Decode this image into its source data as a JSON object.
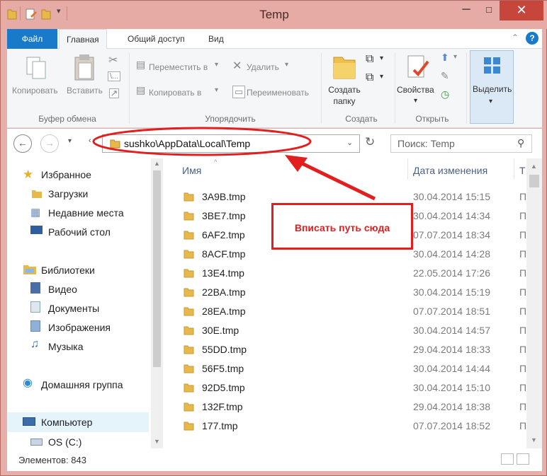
{
  "window": {
    "title": "Temp"
  },
  "tabs": [
    "Файл",
    "Главная",
    "Общий доступ",
    "Вид"
  ],
  "ribbon": {
    "clipboard": {
      "copy": "Копировать",
      "paste": "Вставить",
      "group": "Буфер обмена"
    },
    "organize": {
      "move": "Переместить в",
      "copy_to": "Копировать в",
      "delete": "Удалить",
      "rename": "Переименовать",
      "group": "Упорядочить"
    },
    "create": {
      "new_folder_l1": "Создать",
      "new_folder_l2": "папку",
      "group": "Создать"
    },
    "open": {
      "properties": "Свойства",
      "group": "Открыть"
    },
    "select": {
      "select": "Выделить"
    }
  },
  "address": {
    "path": "sushko\\AppData\\Local\\Temp",
    "search_placeholder": "Поиск: Temp"
  },
  "nav": {
    "favorites": "Избранное",
    "downloads": "Загрузки",
    "recent": "Недавние места",
    "desktop": "Рабочий стол",
    "libraries": "Библиотеки",
    "video": "Видео",
    "documents": "Документы",
    "pictures": "Изображения",
    "music": "Музыка",
    "homegroup": "Домашняя группа",
    "computer": "Компьютер",
    "os_c": "OS (C:)"
  },
  "columns": {
    "name": "Имя",
    "date": "Дата изменения",
    "type": "Т"
  },
  "files": [
    {
      "name": "3A9B.tmp",
      "date": "30.04.2014 15:15",
      "type": "П"
    },
    {
      "name": "3BE7.tmp",
      "date": "30.04.2014 14:34",
      "type": "П"
    },
    {
      "name": "6AF2.tmp",
      "date": "07.07.2014 18:34",
      "type": "П"
    },
    {
      "name": "8ACF.tmp",
      "date": "30.04.2014 14:28",
      "type": "П"
    },
    {
      "name": "13E4.tmp",
      "date": "22.05.2014 17:26",
      "type": "П"
    },
    {
      "name": "22BA.tmp",
      "date": "30.04.2014 15:19",
      "type": "П"
    },
    {
      "name": "28EA.tmp",
      "date": "07.07.2014 18:51",
      "type": "П"
    },
    {
      "name": "30E.tmp",
      "date": "30.04.2014 14:57",
      "type": "П"
    },
    {
      "name": "55DD.tmp",
      "date": "29.04.2014 18:33",
      "type": "П"
    },
    {
      "name": "56F5.tmp",
      "date": "30.04.2014 14:44",
      "type": "П"
    },
    {
      "name": "92D5.tmp",
      "date": "30.04.2014 15:10",
      "type": "П"
    },
    {
      "name": "132F.tmp",
      "date": "29.04.2014 18:38",
      "type": "П"
    },
    {
      "name": "177.tmp",
      "date": "07.07.2014 18:52",
      "type": "П"
    }
  ],
  "status": {
    "items": "Элементов: 843"
  },
  "annotation": {
    "text": "Вписать путь сюда"
  },
  "colors": {
    "accent": "#1979ca",
    "annotation": "#e31e1e",
    "titlebar": "#e6aba5",
    "close": "#c7463c"
  }
}
